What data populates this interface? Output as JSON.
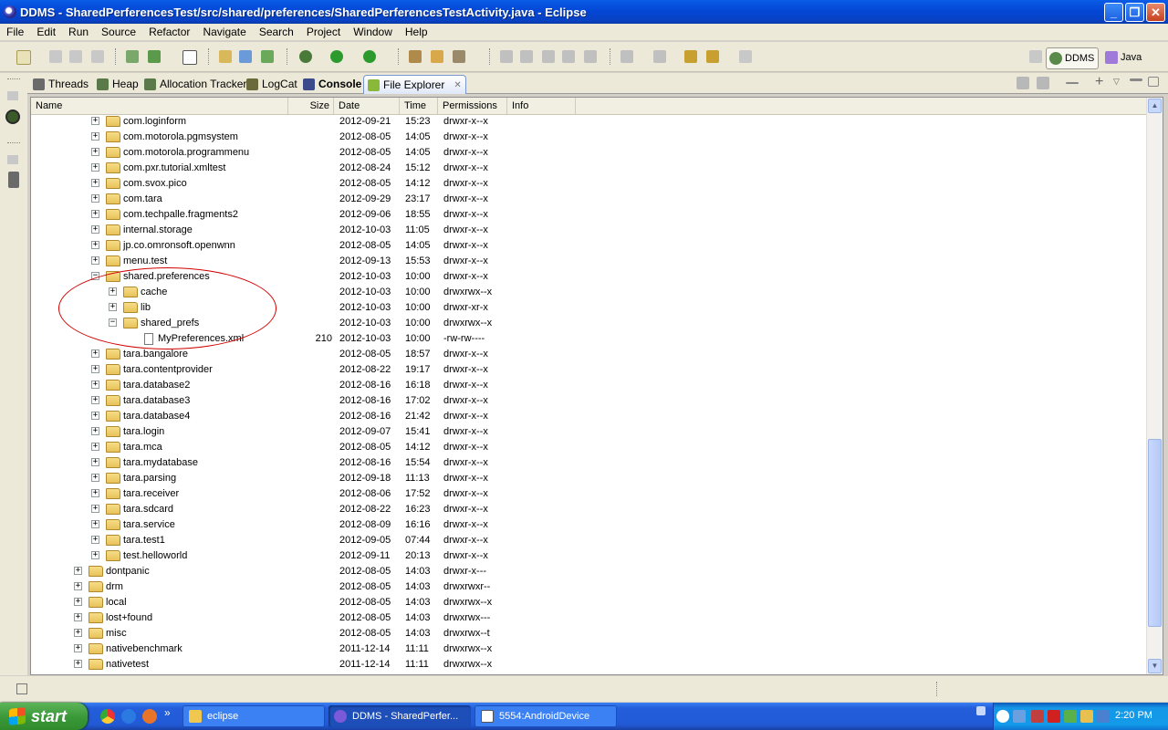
{
  "window": {
    "title": "DDMS - SharedPerferencesTest/src/shared/preferences/SharedPerferencesTestActivity.java - Eclipse",
    "minimize": "_",
    "restore": "❐",
    "close": "✕"
  },
  "menubar": [
    "File",
    "Edit",
    "Run",
    "Source",
    "Refactor",
    "Navigate",
    "Search",
    "Project",
    "Window",
    "Help"
  ],
  "perspectives": {
    "ddms": "DDMS",
    "java": "Java"
  },
  "tabs": [
    {
      "label": "Threads"
    },
    {
      "label": "Heap"
    },
    {
      "label": "Allocation Tracker"
    },
    {
      "label": "LogCat"
    },
    {
      "label": "Console"
    },
    {
      "label": "File Explorer",
      "close": "✕"
    }
  ],
  "columns": [
    "Name",
    "Size",
    "Date",
    "Time",
    "Permissions",
    "Info"
  ],
  "rows": [
    {
      "name": "com.loginform",
      "size": "",
      "date": "2012-09-21",
      "time": "15:23",
      "perm": "drwxr-x--x",
      "exp": "+"
    },
    {
      "name": "com.motorola.pgmsystem",
      "size": "",
      "date": "2012-08-05",
      "time": "14:05",
      "perm": "drwxr-x--x",
      "exp": "+"
    },
    {
      "name": "com.motorola.programmenu",
      "size": "",
      "date": "2012-08-05",
      "time": "14:05",
      "perm": "drwxr-x--x",
      "exp": "+"
    },
    {
      "name": "com.pxr.tutorial.xmltest",
      "size": "",
      "date": "2012-08-24",
      "time": "15:12",
      "perm": "drwxr-x--x",
      "exp": "+"
    },
    {
      "name": "com.svox.pico",
      "size": "",
      "date": "2012-08-05",
      "time": "14:12",
      "perm": "drwxr-x--x",
      "exp": "+"
    },
    {
      "name": "com.tara",
      "size": "",
      "date": "2012-09-29",
      "time": "23:17",
      "perm": "drwxr-x--x",
      "exp": "+"
    },
    {
      "name": "com.techpalle.fragments2",
      "size": "",
      "date": "2012-09-06",
      "time": "18:55",
      "perm": "drwxr-x--x",
      "exp": "+"
    },
    {
      "name": "internal.storage",
      "size": "",
      "date": "2012-10-03",
      "time": "11:05",
      "perm": "drwxr-x--x",
      "exp": "+"
    },
    {
      "name": "jp.co.omronsoft.openwnn",
      "size": "",
      "date": "2012-08-05",
      "time": "14:05",
      "perm": "drwxr-x--x",
      "exp": "+"
    },
    {
      "name": "menu.test",
      "size": "",
      "date": "2012-09-13",
      "time": "15:53",
      "perm": "drwxr-x--x",
      "exp": "+"
    },
    {
      "name": "shared.preferences",
      "size": "",
      "date": "2012-10-03",
      "time": "10:00",
      "perm": "drwxr-x--x",
      "exp": "−"
    },
    {
      "name": "cache",
      "size": "",
      "date": "2012-10-03",
      "time": "10:00",
      "perm": "drwxrwx--x",
      "exp": "+"
    },
    {
      "name": "lib",
      "size": "",
      "date": "2012-10-03",
      "time": "10:00",
      "perm": "drwxr-xr-x",
      "exp": "+"
    },
    {
      "name": "shared_prefs",
      "size": "",
      "date": "2012-10-03",
      "time": "10:00",
      "perm": "drwxrwx--x",
      "exp": "−"
    },
    {
      "name": "MyPreferences.xml",
      "size": "210",
      "date": "2012-10-03",
      "time": "10:00",
      "perm": "-rw-rw----",
      "exp": ""
    },
    {
      "name": "tara.bangalore",
      "size": "",
      "date": "2012-08-05",
      "time": "18:57",
      "perm": "drwxr-x--x",
      "exp": "+"
    },
    {
      "name": "tara.contentprovider",
      "size": "",
      "date": "2012-08-22",
      "time": "19:17",
      "perm": "drwxr-x--x",
      "exp": "+"
    },
    {
      "name": "tara.database2",
      "size": "",
      "date": "2012-08-16",
      "time": "16:18",
      "perm": "drwxr-x--x",
      "exp": "+"
    },
    {
      "name": "tara.database3",
      "size": "",
      "date": "2012-08-16",
      "time": "17:02",
      "perm": "drwxr-x--x",
      "exp": "+"
    },
    {
      "name": "tara.database4",
      "size": "",
      "date": "2012-08-16",
      "time": "21:42",
      "perm": "drwxr-x--x",
      "exp": "+"
    },
    {
      "name": "tara.login",
      "size": "",
      "date": "2012-09-07",
      "time": "15:41",
      "perm": "drwxr-x--x",
      "exp": "+"
    },
    {
      "name": "tara.mca",
      "size": "",
      "date": "2012-08-05",
      "time": "14:12",
      "perm": "drwxr-x--x",
      "exp": "+"
    },
    {
      "name": "tara.mydatabase",
      "size": "",
      "date": "2012-08-16",
      "time": "15:54",
      "perm": "drwxr-x--x",
      "exp": "+"
    },
    {
      "name": "tara.parsing",
      "size": "",
      "date": "2012-09-18",
      "time": "11:13",
      "perm": "drwxr-x--x",
      "exp": "+"
    },
    {
      "name": "tara.receiver",
      "size": "",
      "date": "2012-08-06",
      "time": "17:52",
      "perm": "drwxr-x--x",
      "exp": "+"
    },
    {
      "name": "tara.sdcard",
      "size": "",
      "date": "2012-08-22",
      "time": "16:23",
      "perm": "drwxr-x--x",
      "exp": "+"
    },
    {
      "name": "tara.service",
      "size": "",
      "date": "2012-08-09",
      "time": "16:16",
      "perm": "drwxr-x--x",
      "exp": "+"
    },
    {
      "name": "tara.test1",
      "size": "",
      "date": "2012-09-05",
      "time": "07:44",
      "perm": "drwxr-x--x",
      "exp": "+"
    },
    {
      "name": "test.helloworld",
      "size": "",
      "date": "2012-09-11",
      "time": "20:13",
      "perm": "drwxr-x--x",
      "exp": "+"
    },
    {
      "name": "dontpanic",
      "size": "",
      "date": "2012-08-05",
      "time": "14:03",
      "perm": "drwxr-x---",
      "exp": "+"
    },
    {
      "name": "drm",
      "size": "",
      "date": "2012-08-05",
      "time": "14:03",
      "perm": "drwxrwxr--",
      "exp": "+"
    },
    {
      "name": "local",
      "size": "",
      "date": "2012-08-05",
      "time": "14:03",
      "perm": "drwxrwx--x",
      "exp": "+"
    },
    {
      "name": "lost+found",
      "size": "",
      "date": "2012-08-05",
      "time": "14:03",
      "perm": "drwxrwx---",
      "exp": "+"
    },
    {
      "name": "misc",
      "size": "",
      "date": "2012-08-05",
      "time": "14:03",
      "perm": "drwxrwx--t",
      "exp": "+"
    },
    {
      "name": "nativebenchmark",
      "size": "",
      "date": "2011-12-14",
      "time": "11:11",
      "perm": "drwxrwx--x",
      "exp": "+"
    },
    {
      "name": "nativetest",
      "size": "",
      "date": "2011-12-14",
      "time": "11:11",
      "perm": "drwxrwx--x",
      "exp": "+"
    }
  ],
  "taskbar": {
    "start": "start",
    "tasks": [
      "eclipse",
      "DDMS - SharedPerfer...",
      "5554:AndroidDevice"
    ],
    "clock": "2:20 PM"
  },
  "colors": {
    "titlebar": "#0347d6",
    "annotation": "#d10000",
    "folder": "#e8c25a"
  }
}
